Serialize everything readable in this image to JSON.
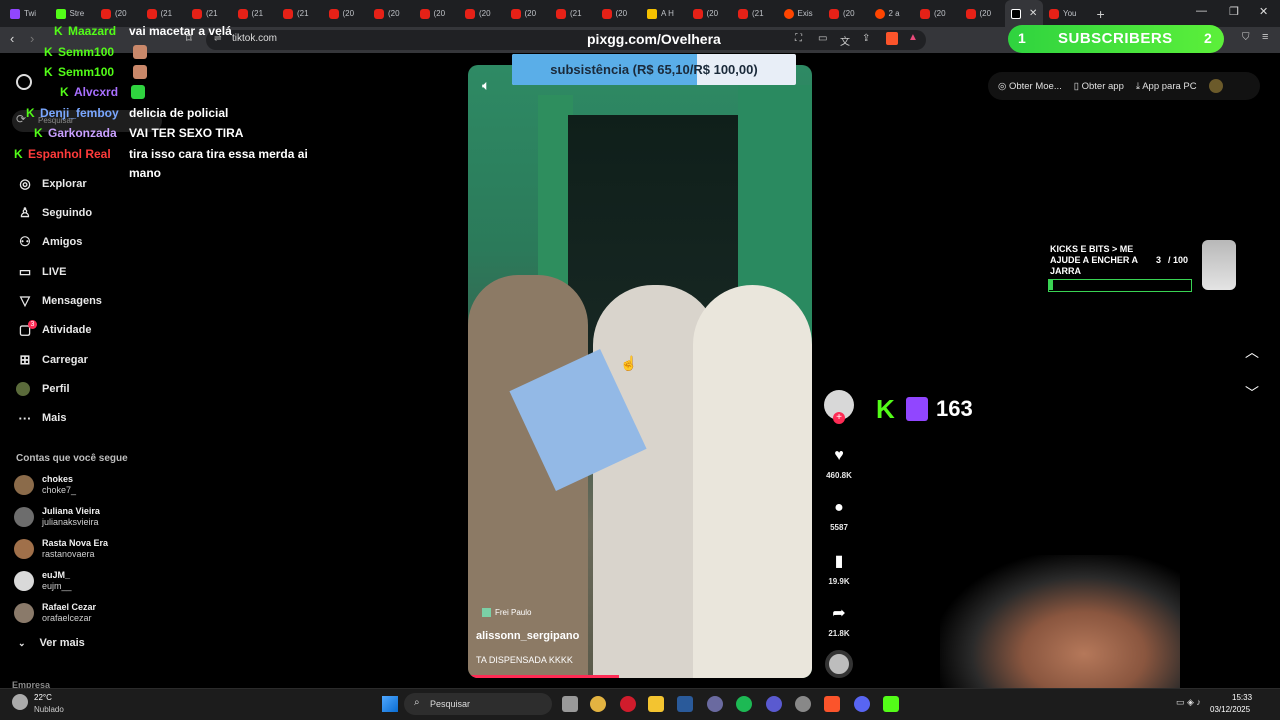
{
  "browser": {
    "tabs": [
      {
        "title": "Twi",
        "icon": "twitch-icon",
        "color": "tw"
      },
      {
        "title": "Stre",
        "icon": "kick-icon",
        "color": "k"
      },
      {
        "title": "(20",
        "icon": "youtube-icon",
        "color": "yt"
      },
      {
        "title": "(21",
        "icon": "youtube-icon",
        "color": "yt"
      },
      {
        "title": "(21",
        "icon": "youtube-icon",
        "color": "yt"
      },
      {
        "title": "(21",
        "icon": "youtube-icon",
        "color": "yt"
      },
      {
        "title": "(21",
        "icon": "youtube-icon",
        "color": "yt"
      },
      {
        "title": "(20",
        "icon": "youtube-icon",
        "color": "yt"
      },
      {
        "title": "(20",
        "icon": "youtube-icon",
        "color": "yt"
      },
      {
        "title": "(20",
        "icon": "youtube-icon",
        "color": "yt"
      },
      {
        "title": "(20",
        "icon": "youtube-icon",
        "color": "yt"
      },
      {
        "title": "(20",
        "icon": "youtube-icon",
        "color": "yt"
      },
      {
        "title": "(21",
        "icon": "youtube-icon",
        "color": "yt"
      },
      {
        "title": "(20",
        "icon": "youtube-icon",
        "color": "yt"
      },
      {
        "title": "A H",
        "icon": "news-icon",
        "color": "yl"
      },
      {
        "title": "(20",
        "icon": "youtube-icon",
        "color": "yt"
      },
      {
        "title": "(21",
        "icon": "youtube-icon",
        "color": "yt"
      },
      {
        "title": "Exis",
        "icon": "reddit-icon",
        "color": "rd"
      },
      {
        "title": "(20",
        "icon": "youtube-icon",
        "color": "yt"
      },
      {
        "title": "2 a",
        "icon": "reddit-icon",
        "color": "rd"
      },
      {
        "title": "(20",
        "icon": "youtube-icon",
        "color": "yt"
      },
      {
        "title": "(20",
        "icon": "youtube-icon",
        "color": "yt"
      }
    ],
    "active_tab_icon": "tiktok-icon",
    "last_tab": "You",
    "new_tab": "+",
    "url": "tiktok.com",
    "min": "—",
    "restore": "❐",
    "close": "✕"
  },
  "overlay": {
    "pix_url": "pixgg.com/Ovelhera",
    "payment_text": "subsistência (R$ 65,10/R$ 100,00)",
    "payment_progress": 0.651,
    "subscribers": {
      "left": "1",
      "label": "SUBSCRIBERS",
      "right": "2"
    },
    "jar": {
      "line1": "KICKS E BITS > ME",
      "line2": "AJUDE A ENCHER A",
      "line3": "JARRA",
      "count": "3",
      "total": "/ 100",
      "progress": 0.03
    },
    "viewers": "163"
  },
  "chat": [
    {
      "user": "Maazard",
      "color": "#53fc18",
      "msg": "vai macetar a velá"
    },
    {
      "user": "Semm100",
      "color": "#53fc18",
      "msg": ""
    },
    {
      "user": "Semm100",
      "color": "#53fc18",
      "msg": ""
    },
    {
      "user": "Alvcxrd",
      "color": "#a970ff",
      "msg": ""
    },
    {
      "user": "Denji_femboy",
      "color": "#7aa7ff",
      "msg": "delicia de policial"
    },
    {
      "user": "Garkonzada",
      "color": "#c9a0ff",
      "msg": "VAI TER SEXO TIRA"
    },
    {
      "user": "Espanhol Real",
      "color": "#ff3b3b",
      "msg": "tira isso cara tira essa merda ai"
    },
    {
      "user": "",
      "color": "#fff",
      "msg": "mano"
    }
  ],
  "tiktok": {
    "search_placeholder": "Pesquisar",
    "nav": [
      {
        "label": "Explorar",
        "icon": "compass-icon",
        "glyph": "◎"
      },
      {
        "label": "Seguindo",
        "icon": "following-icon",
        "glyph": "♙"
      },
      {
        "label": "Amigos",
        "icon": "friends-icon",
        "glyph": "⚇"
      },
      {
        "label": "LIVE",
        "icon": "live-icon",
        "glyph": "▭"
      },
      {
        "label": "Mensagens",
        "icon": "messages-icon",
        "glyph": "▽"
      },
      {
        "label": "Atividade",
        "icon": "activity-icon",
        "glyph": "▢"
      },
      {
        "label": "Carregar",
        "icon": "upload-icon",
        "glyph": "⊞"
      },
      {
        "label": "Perfil",
        "icon": "profile-avatar",
        "glyph": "●"
      },
      {
        "label": "Mais",
        "icon": "more-icon",
        "glyph": "···"
      }
    ],
    "activity_badge": "3",
    "following_header": "Contas que você segue",
    "following": [
      {
        "name": "chokes",
        "handle": "choke7_",
        "color": "#8b6b4a"
      },
      {
        "name": "Juliana Vieira",
        "handle": "julianaksvieira",
        "color": "#6d6d6d"
      },
      {
        "name": "Rasta Nova Era",
        "handle": "rastanovaera",
        "color": "#a0704a"
      },
      {
        "name": "euJM_",
        "handle": "eujm__",
        "color": "#d9d9d9"
      },
      {
        "name": "Rafael Cezar",
        "handle": "orafaelcezar",
        "color": "#8a7a6a"
      }
    ],
    "see_more": "Ver mais",
    "footer": "Empresa",
    "top_buttons": {
      "coins": "Obter Moe...",
      "app": "Obter app",
      "pc": "App para PC"
    },
    "video": {
      "watermark": "Frei Paulo",
      "author": "alissonn_sergipano",
      "caption": "TA DISPENSADA KKKK",
      "progress": 0.44
    },
    "actions": {
      "likes": "460.8K",
      "comments": "5587",
      "saves": "19.9K",
      "shares": "21.8K"
    }
  },
  "taskbar": {
    "weather_temp": "22°C",
    "weather_desc": "Nublado",
    "search": "Pesquisar",
    "time": "15:33",
    "date": "03/12/2025"
  }
}
